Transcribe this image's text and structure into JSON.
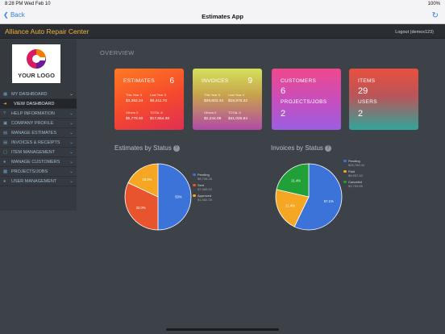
{
  "status_bar": {
    "time": "8:28 PM   Wed Feb 10",
    "right": "100%"
  },
  "nav": {
    "back": "Back",
    "title": "Estimates App"
  },
  "app": {
    "name": "Alliance Auto Repair Center",
    "logout": "Logout (demox123)"
  },
  "logo": {
    "text": "YOUR LOGO"
  },
  "menu": [
    {
      "label": "MY DASHBOARD",
      "sub": false
    },
    {
      "label": "VIEW DASHBOARD",
      "sub": true
    },
    {
      "label": "HELP INFORMATION",
      "sub": false
    },
    {
      "label": "COMPANY PROFILE",
      "sub": false
    },
    {
      "label": "MANAGE ESTIMATES",
      "sub": false
    },
    {
      "label": "INVOICES & RECEIPTS",
      "sub": false
    },
    {
      "label": "ITEM MANAGEMENT",
      "sub": false
    },
    {
      "label": "MANAGE CUSTOMERS",
      "sub": false
    },
    {
      "label": "PROJECTS/JOBS",
      "sub": false
    },
    {
      "label": "USER MANAGEMENT",
      "sub": false
    }
  ],
  "overview_label": "OVERVIEW",
  "cards": {
    "estimates": {
      "title": "ESTIMATES",
      "count": "6",
      "this_year": "This Year 3",
      "last_year": "Last Year 3",
      "this_year_val": "$3,362.24",
      "last_year_val": "$8,411.70",
      "others": "Others 0",
      "total": "TOTAL 6",
      "others_val": "$5,778.40",
      "total_val": "$17,654.38"
    },
    "invoices": {
      "title": "INVOICES",
      "count": "9",
      "this_year": "This Year 5",
      "last_year": "Last Year 4",
      "this_year_val": "$28,603.43",
      "last_year_val": "$18,975.22",
      "others": "Others 0",
      "total": "TOTAL 9",
      "others_val": "$2,244.09",
      "total_val": "$41,025.64"
    },
    "customers": {
      "title": "CUSTOMERS",
      "count": "6",
      "projects_title": "PROJECTS/JOBS",
      "projects_count": "2"
    },
    "items": {
      "title": "ITEMS",
      "count": "29",
      "users_title": "USERS",
      "users_count": "2"
    }
  },
  "estimates_chart": {
    "title": "Estimates by Status",
    "legend": [
      {
        "label": "Pending",
        "value": "$8,706.28",
        "color": "#3b73d9"
      },
      {
        "label": "Sent",
        "value": "$7,465.92",
        "color": "#e8542e"
      },
      {
        "label": "Approved",
        "value": "$1,582.28",
        "color": "#f5a623"
      }
    ]
  },
  "invoices_chart": {
    "title": "Invoices by Status",
    "legend": [
      {
        "label": "Pending",
        "value": "$26,769.44",
        "color": "#3b73d9"
      },
      {
        "label": "Paid",
        "value": "$8,957.40",
        "color": "#f5a623"
      },
      {
        "label": "Canceled",
        "value": "$3,704.65",
        "color": "#21a038"
      }
    ]
  },
  "chart_data": [
    {
      "type": "pie",
      "title": "Estimates by Status",
      "categories": [
        "Pending",
        "Sent",
        "Approved"
      ],
      "values": [
        50.0,
        32.0,
        18.0
      ],
      "labels": [
        "50%",
        "32.0%",
        "18.0%"
      ],
      "colors": [
        "#3b73d9",
        "#e8542e",
        "#f5a623"
      ]
    },
    {
      "type": "pie",
      "title": "Invoices by Status",
      "categories": [
        "Pending",
        "Paid",
        "Canceled"
      ],
      "values": [
        57.1,
        21.4,
        21.4
      ],
      "labels": [
        "57.1%",
        "21.4%",
        "21.4%"
      ],
      "colors": [
        "#3b73d9",
        "#f5a623",
        "#21a038"
      ]
    }
  ]
}
